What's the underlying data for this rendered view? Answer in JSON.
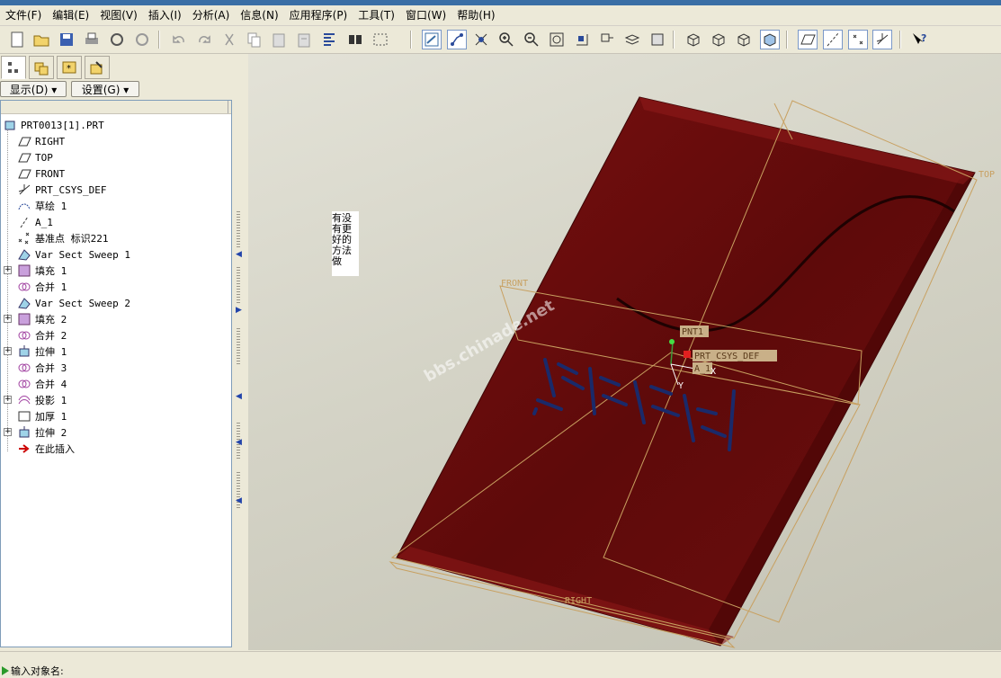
{
  "menu": [
    "文件(F)",
    "编辑(E)",
    "视图(V)",
    "插入(I)",
    "分析(A)",
    "信息(N)",
    "应用程序(P)",
    "工具(T)",
    "窗口(W)",
    "帮助(H)"
  ],
  "toolbar_icons": [
    "new-icon",
    "open-icon",
    "save-icon",
    "print-icon",
    "model-tree-icon",
    "regenerate-icon",
    "undo-icon",
    "redo-icon",
    "cut-icon",
    "copy-icon",
    "paste-icon",
    "paste-special-icon",
    "regenerate-manager-icon",
    "find-icon",
    "select-box-icon",
    "repaint-icon",
    "spin-center-icon",
    "orient-icon",
    "zoom-in-icon",
    "zoom-out-icon",
    "refit-icon",
    "reorient-icon",
    "saved-views-icon",
    "layers-icon",
    "appearance-icon",
    "wireframe-icon",
    "hidden-line-icon",
    "no-hidden-icon",
    "shading-icon",
    "datum-planes-icon",
    "datum-axes-icon",
    "datum-points-icon",
    "coordinate-systems-icon",
    "context-help-icon"
  ],
  "left_tabs": [
    "model-tree-tab-icon",
    "folder-browser-tab-icon",
    "favorites-tab-icon",
    "connections-tab-icon"
  ],
  "dropdowns": {
    "show": "显示(D)",
    "settings": "设置(G)"
  },
  "tree": [
    {
      "label": "PRT0013[1].PRT",
      "icon": "part-icon",
      "expandable": false,
      "indent": 0
    },
    {
      "label": "RIGHT",
      "icon": "datum-plane-icon",
      "expandable": false,
      "indent": 1
    },
    {
      "label": "TOP",
      "icon": "datum-plane-icon",
      "expandable": false,
      "indent": 1
    },
    {
      "label": "FRONT",
      "icon": "datum-plane-icon",
      "expandable": false,
      "indent": 1
    },
    {
      "label": "PRT_CSYS_DEF",
      "icon": "csys-icon",
      "expandable": false,
      "indent": 1
    },
    {
      "label": "草绘 1",
      "icon": "sketch-icon",
      "expandable": false,
      "indent": 1
    },
    {
      "label": "A_1",
      "icon": "axis-icon",
      "expandable": false,
      "indent": 1
    },
    {
      "label": "基准点 标识221",
      "icon": "datum-point-icon",
      "expandable": false,
      "indent": 1
    },
    {
      "label": "Var Sect Sweep 1",
      "icon": "sweep-icon",
      "expandable": false,
      "indent": 1
    },
    {
      "label": "填充 1",
      "icon": "fill-icon",
      "expandable": true,
      "indent": 1
    },
    {
      "label": "合并 1",
      "icon": "merge-icon",
      "expandable": false,
      "indent": 1
    },
    {
      "label": "Var Sect Sweep 2",
      "icon": "sweep-icon",
      "expandable": false,
      "indent": 1
    },
    {
      "label": "填充 2",
      "icon": "fill-icon",
      "expandable": true,
      "indent": 1
    },
    {
      "label": "合并 2",
      "icon": "merge-icon",
      "expandable": false,
      "indent": 1
    },
    {
      "label": "拉伸 1",
      "icon": "extrude-icon",
      "expandable": true,
      "indent": 1
    },
    {
      "label": "合并 3",
      "icon": "merge-icon",
      "expandable": false,
      "indent": 1
    },
    {
      "label": "合并 4",
      "icon": "merge-icon",
      "expandable": false,
      "indent": 1
    },
    {
      "label": "投影 1",
      "icon": "project-icon",
      "expandable": true,
      "indent": 1
    },
    {
      "label": "加厚 1",
      "icon": "thicken-icon",
      "expandable": false,
      "indent": 1
    },
    {
      "label": "拉伸 2",
      "icon": "extrude-icon",
      "expandable": true,
      "indent": 1
    },
    {
      "label": "在此插入",
      "icon": "insert-here-icon",
      "expandable": false,
      "indent": 1
    }
  ],
  "note_text": "有没有更好的方法做",
  "canvas_labels": {
    "front": "FRONT",
    "top": "TOP",
    "right": "RIGHT",
    "pnt": "PNT1",
    "csys": "PRT_CSYS_DEF",
    "axis": "A_1",
    "csys_x": "X",
    "csys_y": "Y",
    "watermark": "bbs.chinade.net"
  },
  "status": {
    "prompt": "输入对象名:"
  },
  "colors": {
    "model": "#6a0d0d",
    "datum": "#c8a060",
    "embossed_text": "#1a2a6a"
  }
}
